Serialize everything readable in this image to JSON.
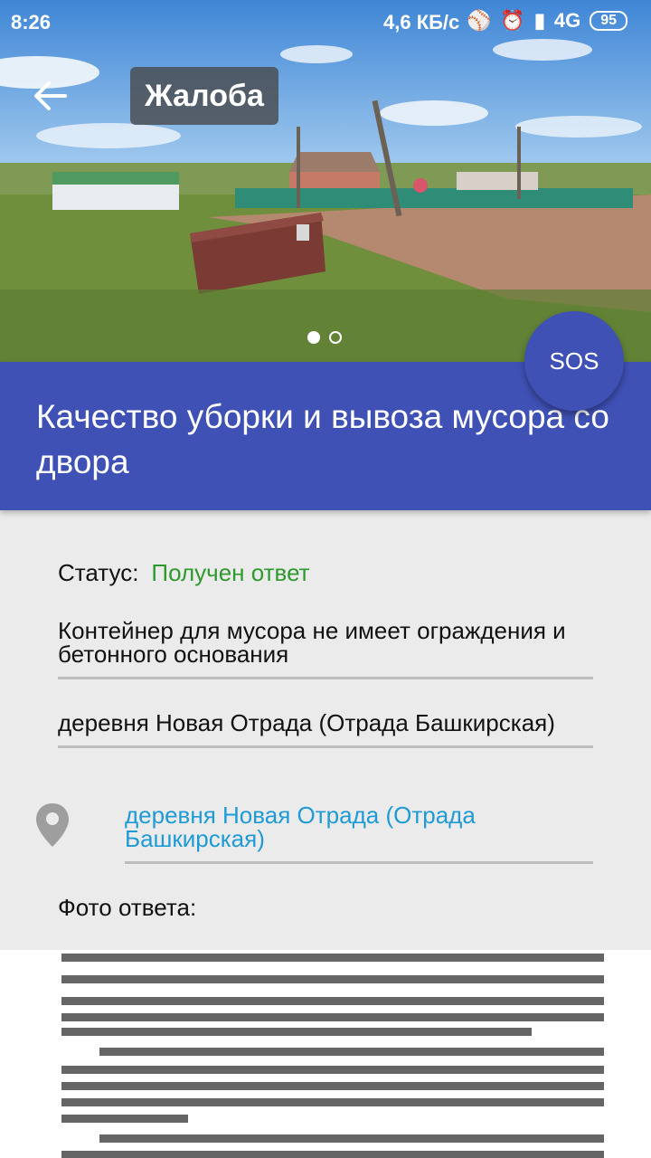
{
  "status_bar": {
    "time": "8:26",
    "network_speed": "4,6 КБ/с",
    "network_type": "4G",
    "battery": "95"
  },
  "header": {
    "title": "Жалоба"
  },
  "gallery": {
    "dots_total": 2,
    "active_index": 0
  },
  "sos_label": "SOS",
  "banner": {
    "title": "Качество уборки и вывоза мусора со двора"
  },
  "details": {
    "status_label": "Статус:",
    "status_value": "Получен ответ",
    "status_color": "#2e9a2e",
    "description": "Контейнер для мусора не имеет ограждения и бетонного основания",
    "location_text": "деревня Новая Отрада (Отрада Башкирская)",
    "location_link": "деревня Новая Отрада (Отрада Башкирская)",
    "photo_label": "Фото ответа:"
  },
  "colors": {
    "primary": "#3f51b5",
    "link": "#1e9bd7"
  }
}
